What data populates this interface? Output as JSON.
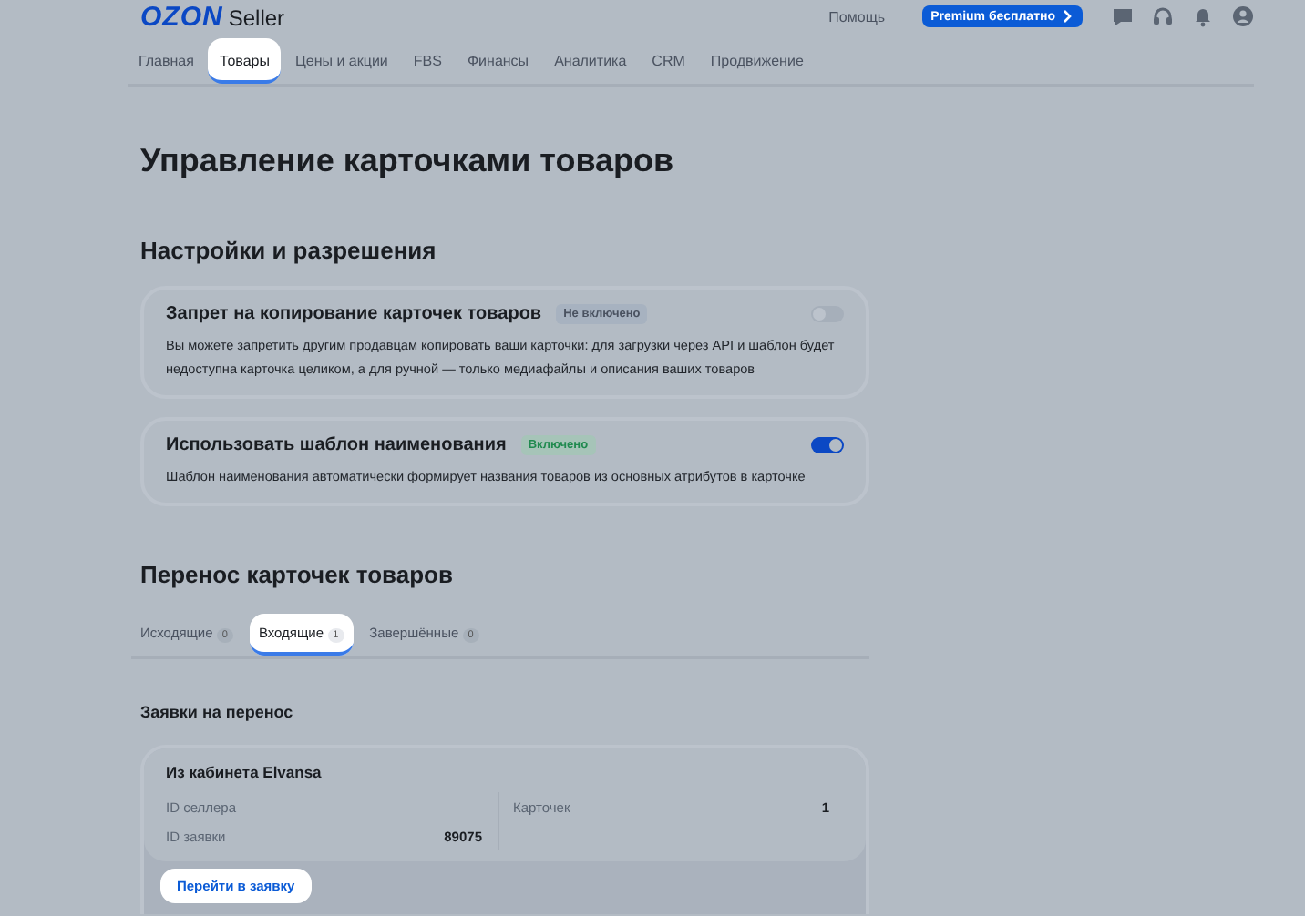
{
  "header": {
    "logo": "OZON",
    "logo_suffix": "Seller",
    "help": "Помощь",
    "premium_button": "Premium бесплатно"
  },
  "nav": [
    {
      "label": "Главная",
      "selected": false
    },
    {
      "label": "Товары",
      "selected": true
    },
    {
      "label": "Цены и акции",
      "selected": false
    },
    {
      "label": "FBS",
      "selected": false
    },
    {
      "label": "Финансы",
      "selected": false
    },
    {
      "label": "Аналитика",
      "selected": false
    },
    {
      "label": "CRM",
      "selected": false
    },
    {
      "label": "Продвижение",
      "selected": false
    }
  ],
  "page_title": "Управление карточками товаров",
  "settings": {
    "title": "Настройки и разрешения",
    "items": [
      {
        "title": "Запрет на копирование карточек товаров",
        "status": "Не включено",
        "on": false,
        "description": "Вы можете запретить другим продавцам копировать ваши карточки: для загрузки через API и шаблон будет недоступна карточка целиком, а для ручной — только медиафайлы и описания ваших товаров"
      },
      {
        "title": "Использовать шаблон наименования",
        "status": "Включено",
        "on": true,
        "description": "Шаблон наименования автоматически формирует названия товаров из основных атрибутов в карточке"
      }
    ]
  },
  "transfer": {
    "title": "Перенос карточек товаров",
    "tabs": [
      {
        "label": "Исходящие",
        "count": "0",
        "selected": false
      },
      {
        "label": "Входящие",
        "count": "1",
        "selected": true
      },
      {
        "label": "Завершённые",
        "count": "0",
        "selected": false
      }
    ],
    "requests_title": "Заявки на перенос",
    "request": {
      "title": "Из кабинета Elvansa",
      "seller_id_label": "ID селлера",
      "request_id_label": "ID заявки",
      "request_id": "89075",
      "cards_label": "Карточек",
      "cards": "1",
      "button": "Перейти в заявку"
    }
  }
}
